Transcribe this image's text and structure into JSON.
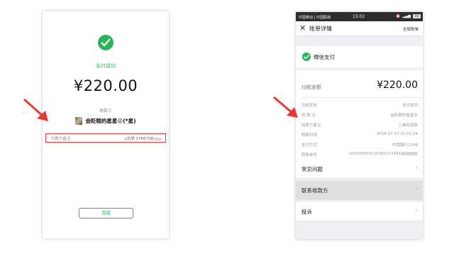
{
  "left": {
    "status": "支付成功",
    "amount": "¥220.00",
    "payee_label": "收款人",
    "payee_name": "会眨眼的星星😜(*星)",
    "note_label": "付款方备注",
    "note_value": "x志旭 1766738",
    "done_button": "完成"
  },
  "right": {
    "status_bar": {
      "carrier": "中国移动 | 中国联通",
      "time": "15:02",
      "battery": "84"
    },
    "nav": {
      "close": "✕",
      "title": "账单详情",
      "all_bills": "全部账单"
    },
    "wechat_pay": "微信支付",
    "amount_label": "付款金额",
    "amount_value": "¥220.00",
    "rows": [
      {
        "key": "当前状态",
        "value": "支付成功"
      },
      {
        "key": "收 款 方",
        "value": "会眨眼的星星😜"
      },
      {
        "key": "收款方备注",
        "value": "二维码收款"
      },
      {
        "key": "转账时间",
        "value": "2018-07-23 15:01:24"
      },
      {
        "key": "支付方式",
        "value": "中国银行1248"
      },
      {
        "key": "转账单号",
        "value": "100005000120180723341"
      }
    ],
    "menu": [
      {
        "label": "常见问题",
        "chevron": "›"
      },
      {
        "label": "联系收款方",
        "chevron": "›"
      },
      {
        "label": "投诉",
        "chevron": "›"
      }
    ]
  },
  "colors": {
    "wechat_green": "#2bb55b",
    "highlight_red": "#e53935"
  },
  "icons": [
    "checkmark-icon",
    "wechat-pay-icon",
    "close-icon",
    "chevron-right-icon",
    "red-arrow"
  ]
}
